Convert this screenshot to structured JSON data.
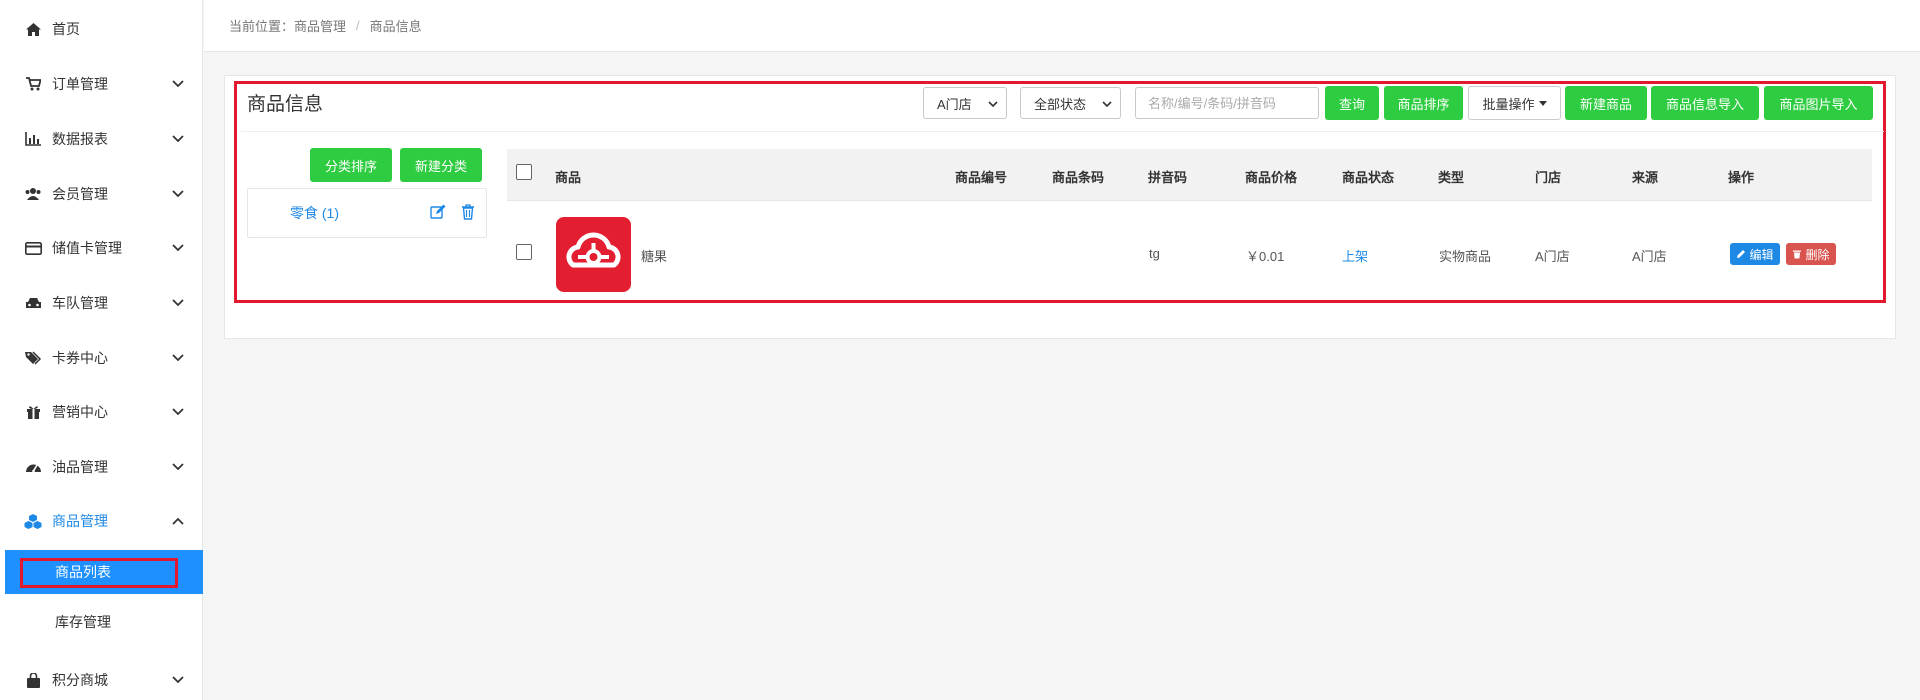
{
  "sidebar": {
    "items": [
      {
        "label": "首页",
        "icon": "home-icon"
      },
      {
        "label": "订单管理",
        "icon": "cart-icon"
      },
      {
        "label": "数据报表",
        "icon": "bar-chart-icon"
      },
      {
        "label": "会员管理",
        "icon": "users-icon"
      },
      {
        "label": "储值卡管理",
        "icon": "credit-card-icon"
      },
      {
        "label": "车队管理",
        "icon": "car-icon"
      },
      {
        "label": "卡券中心",
        "icon": "tags-icon"
      },
      {
        "label": "营销中心",
        "icon": "gift-icon"
      },
      {
        "label": "油品管理",
        "icon": "dashboard-icon"
      },
      {
        "label": "商品管理",
        "icon": "cubes-icon"
      },
      {
        "label": "积分商城",
        "icon": "shopping-bag-icon"
      }
    ],
    "sub_items": [
      {
        "label": "商品列表"
      },
      {
        "label": "库存管理"
      }
    ]
  },
  "breadcrumb": {
    "prefix": "当前位置：",
    "level1": "商品管理",
    "separator": "/",
    "level2": "商品信息"
  },
  "panel": {
    "title": "商品信息"
  },
  "toolbar": {
    "store_select": "A门店",
    "status_select": "全部状态",
    "search_placeholder": "名称/编号/条码/拼音码",
    "query_btn": "查询",
    "sort_btn": "商品排序",
    "batch_btn": "批量操作",
    "new_btn": "新建商品",
    "import_info_btn": "商品信息导入",
    "import_img_btn": "商品图片导入"
  },
  "categories": {
    "sort_btn": "分类排序",
    "new_btn": "新建分类",
    "items": [
      {
        "label": "零食 (1)"
      }
    ]
  },
  "table": {
    "headers": {
      "product": "商品",
      "code": "商品编号",
      "barcode": "商品条码",
      "pinyin": "拼音码",
      "price": "商品价格",
      "status": "商品状态",
      "type": "类型",
      "store": "门店",
      "source": "来源",
      "actions": "操作"
    },
    "rows": [
      {
        "name": "糖果",
        "code": "",
        "barcode": "",
        "pinyin": "tg",
        "price": "￥0.01",
        "status": "上架",
        "type": "实物商品",
        "store": "A门店",
        "source": "A门店",
        "edit": "编辑",
        "delete": "删除"
      }
    ]
  },
  "colors": {
    "primary_green": "#2ecc40",
    "accent_blue": "#1e90ff",
    "highlight_red": "#e0192e",
    "danger_red": "#d9534f",
    "product_image_red": "#e31e30"
  }
}
